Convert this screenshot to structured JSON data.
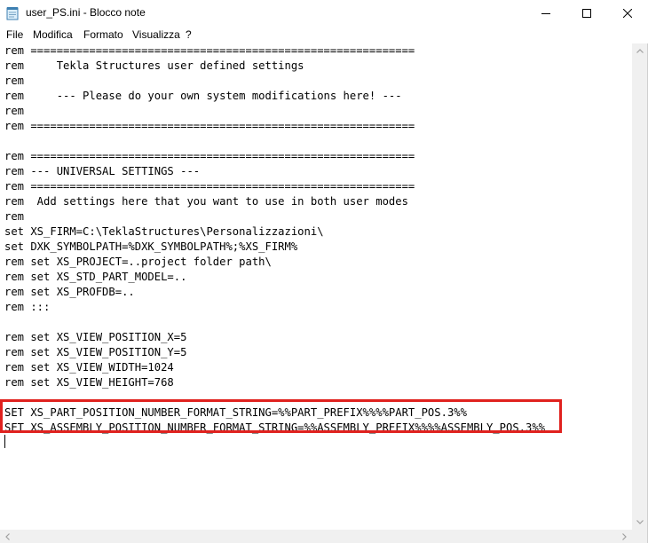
{
  "window": {
    "title": "user_PS.ini - Blocco note",
    "icon": "notepad-icon",
    "controls": [
      "minimize-icon",
      "maximize-icon",
      "close-icon"
    ]
  },
  "menu": [
    "File",
    "Modifica",
    "Formato",
    "Visualizza",
    "?"
  ],
  "editor": {
    "lines": [
      "rem ===========================================================",
      "rem     Tekla Structures user defined settings",
      "rem",
      "rem     --- Please do your own system modifications here! ---",
      "rem",
      "rem ===========================================================",
      "",
      "rem ===========================================================",
      "rem --- UNIVERSAL SETTINGS ---",
      "rem ===========================================================",
      "rem  Add settings here that you want to use in both user modes",
      "rem",
      "set XS_FIRM=C:\\TeklaStructures\\Personalizzazioni\\",
      "set DXK_SYMBOLPATH=%DXK_SYMBOLPATH%;%XS_FIRM%",
      "rem set XS_PROJECT=..project folder path\\",
      "rem set XS_STD_PART_MODEL=..",
      "rem set XS_PROFDB=..",
      "rem :::",
      "",
      "rem set XS_VIEW_POSITION_X=5",
      "rem set XS_VIEW_POSITION_Y=5",
      "rem set XS_VIEW_WIDTH=1024",
      "rem set XS_VIEW_HEIGHT=768",
      "",
      "SET XS_PART_POSITION_NUMBER_FORMAT_STRING=%%PART_PREFIX%%%%PART_POS.3%%",
      "SET XS_ASSEMBLY_POSITION_NUMBER_FORMAT_STRING=%%ASSEMBLY_PREFIX%%%%ASSEMBLY_POS.3%%"
    ],
    "highlight_color": "#e0211e"
  }
}
